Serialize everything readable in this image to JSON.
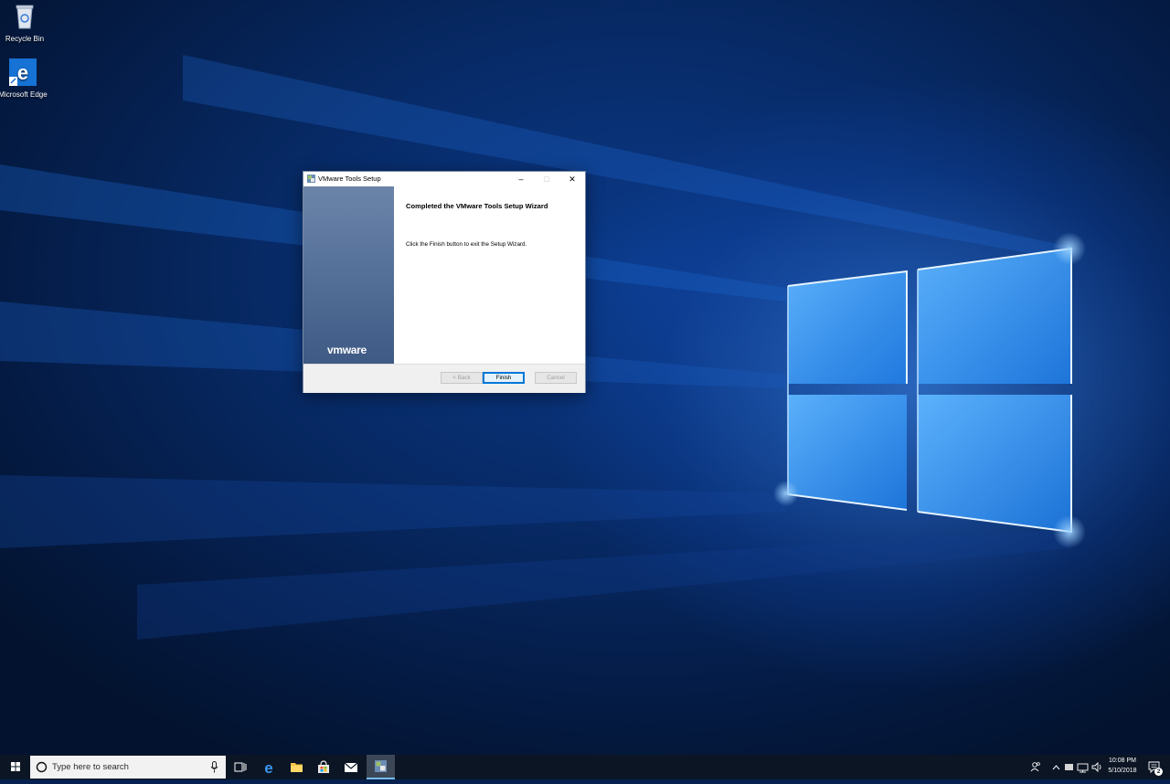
{
  "desktop": {
    "icons": [
      {
        "label": "Recycle Bin"
      },
      {
        "label": "Microsoft Edge"
      }
    ]
  },
  "dialog": {
    "title": "VMware Tools Setup",
    "brand": "vmware",
    "heading": "Completed the VMware Tools Setup Wizard",
    "message": "Click the Finish button to exit the Setup Wizard.",
    "buttons": {
      "back": "< Back",
      "finish": "Finish",
      "cancel": "Cancel"
    }
  },
  "taskbar": {
    "search_placeholder": "Type here to search",
    "clock": {
      "time": "10:08 PM",
      "date": "5/10/2018"
    },
    "notification_count": "2"
  },
  "colors": {
    "taskbar": "#0b1524",
    "dialog_side_panel": "#56719a",
    "accent": "#0078d7"
  }
}
